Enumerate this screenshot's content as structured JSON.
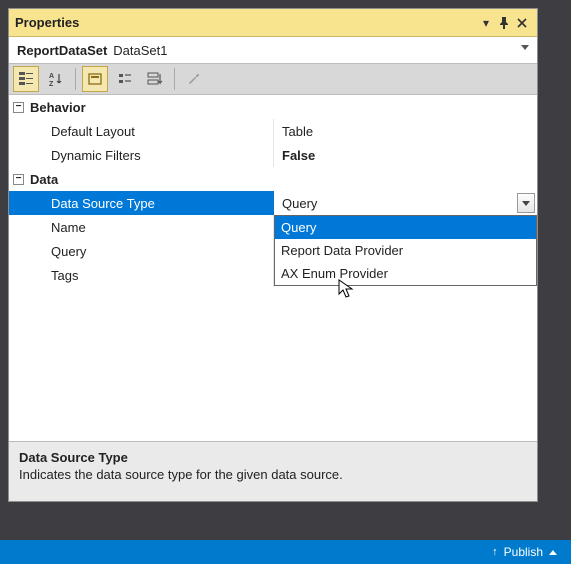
{
  "window": {
    "title": "Properties"
  },
  "selector": {
    "object": "ReportDataSet",
    "class": "DataSet1"
  },
  "categories": {
    "behavior": {
      "label": "Behavior",
      "props": {
        "default_layout": {
          "label": "Default Layout",
          "value": "Table"
        },
        "dynamic_filters": {
          "label": "Dynamic Filters",
          "value": "False"
        }
      }
    },
    "data": {
      "label": "Data",
      "props": {
        "data_source_type": {
          "label": "Data Source Type",
          "value": "Query"
        },
        "name": {
          "label": "Name",
          "value": ""
        },
        "query": {
          "label": "Query",
          "value": ""
        },
        "tags": {
          "label": "Tags",
          "value": ""
        }
      }
    }
  },
  "dropdown": {
    "options": {
      "query": "Query",
      "rdp": "Report Data Provider",
      "axenum": "AX Enum Provider"
    }
  },
  "description": {
    "title": "Data Source Type",
    "text": "Indicates the data source type for the given data source."
  },
  "statusbar": {
    "publish": "Publish"
  }
}
